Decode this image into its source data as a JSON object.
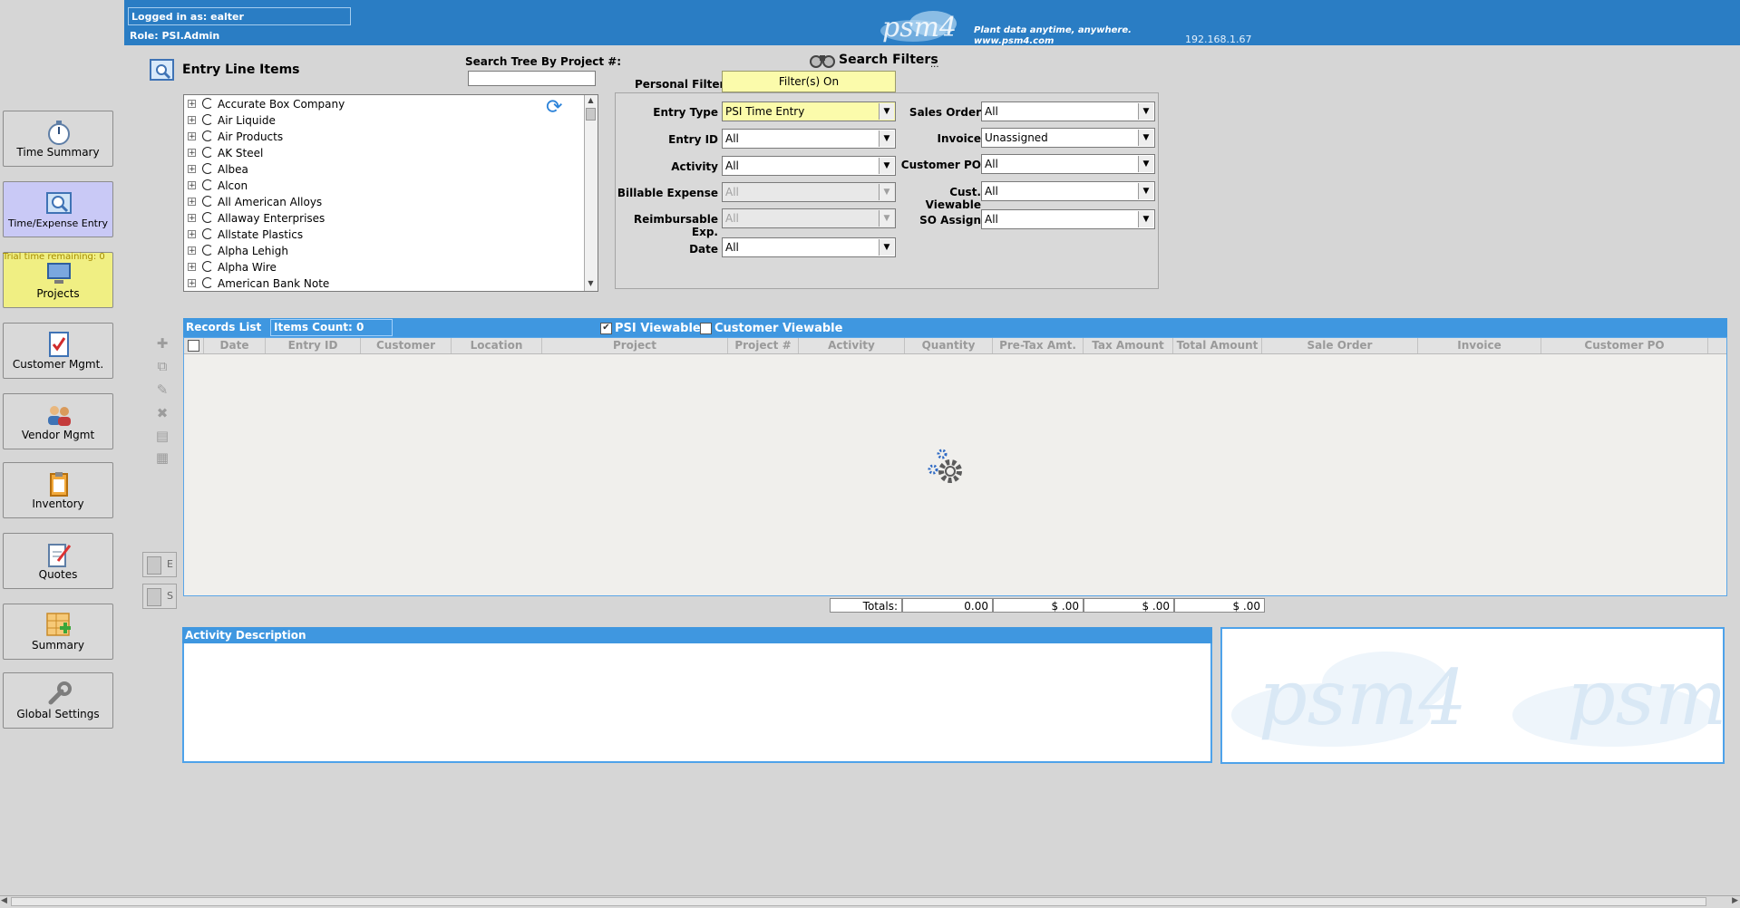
{
  "header": {
    "logged_in": "Logged in as: ealter",
    "role": "Role:  PSI.Admin",
    "logo_text": "psm4",
    "tagline_1": "Plant data anytime, anywhere.",
    "tagline_2": "www.psm4.com",
    "ip": "192.168.1.67",
    "brand_color": "#2a7dc4"
  },
  "sidebar": {
    "trial_text": "Trial time remaining: 0",
    "items": [
      {
        "label": "Time Summary",
        "icon": "stopwatch-icon"
      },
      {
        "label": "Time/Expense Entry",
        "icon": "magnifier-grid-icon"
      },
      {
        "label": "Projects",
        "icon": "computer-icon"
      },
      {
        "label": "Customer Mgmt.",
        "icon": "checklist-icon"
      },
      {
        "label": "Vendor Mgmt",
        "icon": "people-icon"
      },
      {
        "label": "Inventory",
        "icon": "clipboard-icon"
      },
      {
        "label": "Quotes",
        "icon": "notepad-pencil-icon"
      },
      {
        "label": "Summary",
        "icon": "grid-plus-icon"
      },
      {
        "label": "Global Settings",
        "icon": "wrench-icon"
      }
    ]
  },
  "entry_line_items": {
    "title": "Entry Line Items",
    "search_tree_label": "Search Tree By Project #:",
    "search_tree_value": "",
    "tree": [
      "Accurate Box Company",
      "Air Liquide",
      "Air Products",
      "AK Steel",
      "Albea",
      "Alcon",
      "All American Alloys",
      "Allaway Enterprises",
      "Allstate Plastics",
      "Alpha Lehigh",
      "Alpha Wire",
      "American Bank Note"
    ]
  },
  "search_filters": {
    "title": "Search Filters",
    "ellipsis": "...",
    "personal_filters_label": "Personal Filters",
    "personal_filters_button": "Filter(s) On",
    "left": [
      {
        "label": "Entry Type",
        "value": "PSI Time Entry",
        "style": "yellow"
      },
      {
        "label": "Entry ID",
        "value": "All",
        "style": "normal"
      },
      {
        "label": "Activity",
        "value": "All",
        "style": "normal"
      },
      {
        "label": "Billable Expense",
        "value": "All",
        "style": "disabled"
      },
      {
        "label": "Reimbursable Exp.",
        "value": "All",
        "style": "disabled"
      },
      {
        "label": "Date",
        "value": "All",
        "style": "normal"
      }
    ],
    "right": [
      {
        "label": "Sales Order",
        "value": "All"
      },
      {
        "label": "Invoice",
        "value": "Unassigned"
      },
      {
        "label": "Customer PO",
        "value": "All"
      },
      {
        "label": "Cust. Viewable",
        "value": "All"
      },
      {
        "label": "SO Assign",
        "value": "All"
      }
    ]
  },
  "records": {
    "list_label": "Records List",
    "items_count": "Items Count:  0",
    "psi_viewable": "PSI Viewable",
    "psi_viewable_checked": true,
    "customer_viewable": "Customer Viewable",
    "customer_viewable_checked": false,
    "columns": [
      "Date",
      "Entry ID",
      "Customer",
      "Location",
      "Project",
      "Project #",
      "Activity",
      "Quantity",
      "Pre-Tax Amt.",
      "Tax Amount",
      "Total Amount",
      "Sale Order",
      "Invoice",
      "Customer PO"
    ],
    "e_button": "E",
    "s_button": "S"
  },
  "totals": {
    "label": "Totals:",
    "quantity": "0.00",
    "pretax": "$ .00",
    "tax": "$ .00",
    "total": "$ .00"
  },
  "activity": {
    "title": "Activity Description",
    "text": ""
  }
}
